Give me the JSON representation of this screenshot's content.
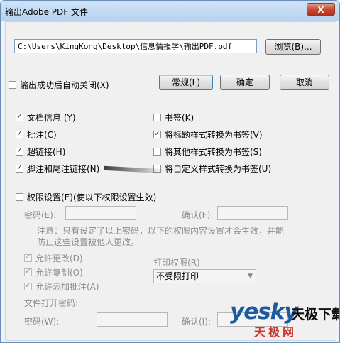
{
  "window": {
    "title": "输出Adobe PDF 文件",
    "close_label": "X"
  },
  "path": {
    "value": "C:\\Users\\KingKong\\Desktop\\信息情报学\\输出PDF.pdf",
    "browse_label": "浏览(B)..."
  },
  "options": {
    "auto_close": {
      "label": "输出成功后自动关闭(X)",
      "checked": false
    },
    "general_label": "常规(L)",
    "ok_label": "确定",
    "cancel_label": "取消"
  },
  "features": [
    {
      "label": "文档信息 (Y)",
      "checked": true
    },
    {
      "label": "书签(K)",
      "checked": false
    },
    {
      "label": "批注(C)",
      "checked": true
    },
    {
      "label": "将标题样式转换为书签(V)",
      "checked": true
    },
    {
      "label": "超链接(H)",
      "checked": true
    },
    {
      "label": "将其他样式转换为书签(S)",
      "checked": false
    },
    {
      "label": "脚注和尾注链接(N)",
      "checked": true
    },
    {
      "label": "将自定义样式转换为书签(U)",
      "checked": false
    }
  ],
  "permissions": {
    "label": "权限设置(E)(使以下权限设置生效)",
    "checked": false,
    "password_label": "密码(E):",
    "confirm_label": "确认(F):",
    "note": "注意：只有设定了以上密码，以下的权限内容设置才会生效，并能防止这些设置被他人更改。",
    "allow_change": "允许更改(D)",
    "allow_copy": "允许复制(O)",
    "allow_comment": "允许添加批注(A)",
    "print_label": "打印权限(R)",
    "print_value": "不受限打印",
    "open_password_label": "文件打开密码:",
    "open_pwd_label": "密码(W):",
    "open_confirm_label": "确认(I):"
  },
  "watermark": {
    "main": "yesky",
    "side": "天极下载",
    "sub": "天极网"
  }
}
